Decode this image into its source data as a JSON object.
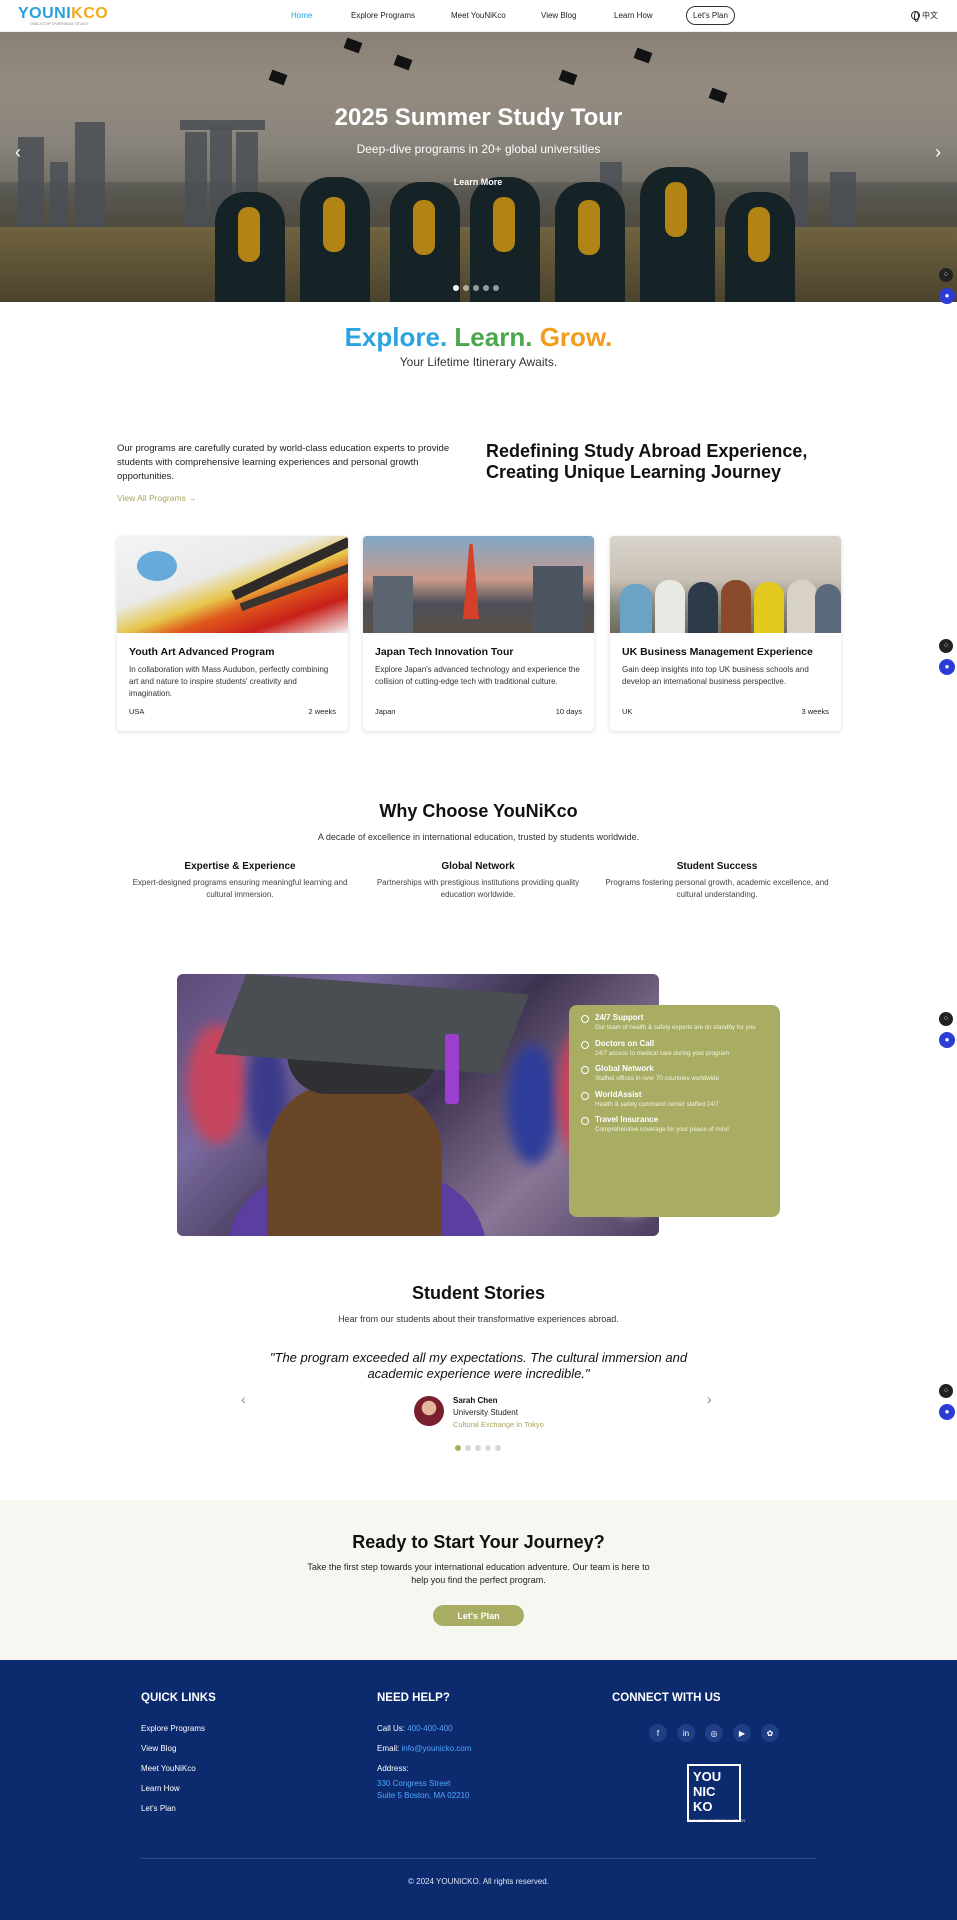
{
  "nav": {
    "logo_part1": "YOUNI",
    "logo_part2": "KCO",
    "logo_tagline": "ONE-STOP OVERSEAS STUDY",
    "links": [
      "Home",
      "Explore Programs",
      "Meet YouNiKco",
      "View Blog",
      "Learn How"
    ],
    "plan_button": "Let's Plan",
    "language": "中文"
  },
  "hero": {
    "title": "2025 Summer Study Tour",
    "subtitle": "Deep-dive programs in 20+ global universities",
    "button": "Learn More",
    "prev": "‹",
    "next": "›",
    "slide_count": 5,
    "active_slide": 1
  },
  "tagline": {
    "word1": "Explore.",
    "word2": "Learn.",
    "word3": "Grow.",
    "sub": "Your Lifetime Itinerary Awaits.",
    "colors": {
      "word1": "#2aa3e0",
      "word2": "#4aa84c",
      "word3": "#f29c1e"
    }
  },
  "intro": {
    "paragraph": "Our programs are carefully curated by world-class education experts to provide students with comprehensive learning experiences and personal growth opportunities.",
    "link": "View All Programs →",
    "heading": "Redefining Study Abroad Experience, Creating Unique Learning Journey"
  },
  "programs": [
    {
      "title": "Youth Art Advanced Program",
      "desc": "In collaboration with Mass Audubon, perfectly combining art and nature to inspire students' creativity and imagination.",
      "location": "USA",
      "duration": "2 weeks"
    },
    {
      "title": "Japan Tech Innovation Tour",
      "desc": "Explore Japan's advanced technology and experience the collision of cutting-edge tech with traditional culture.",
      "location": "Japan",
      "duration": "10 days"
    },
    {
      "title": "UK Business Management Experience",
      "desc": "Gain deep insights into top UK business schools and develop an international business perspective.",
      "location": "UK",
      "duration": "3 weeks"
    }
  ],
  "why": {
    "heading": "Why Choose YouNiKco",
    "sub": "A decade of excellence in international education, trusted by students worldwide.",
    "features": [
      {
        "title": "Expertise & Experience",
        "desc": "Expert-designed programs ensuring meaningful learning and cultural immersion."
      },
      {
        "title": "Global Network",
        "desc": "Partnerships with prestigious institutions providing quality education worldwide."
      },
      {
        "title": "Student Success",
        "desc": "Programs fostering personal growth, academic excellence, and cultural understanding."
      }
    ]
  },
  "support": [
    {
      "title": "24/7 Support",
      "desc": "Our team of health & safety experts are on standby for you"
    },
    {
      "title": "Doctors on Call",
      "desc": "24/7 access to medical care during your program"
    },
    {
      "title": "Global Network",
      "desc": "Staffed offices in over 70 countries worldwide"
    },
    {
      "title": "WorldAssist",
      "desc": "Health & safety command center staffed 24/7"
    },
    {
      "title": "Travel Insurance",
      "desc": "Comprehensive coverage for your peace of mind"
    }
  ],
  "stories": {
    "heading": "Student Stories",
    "sub": "Hear from our students about their transformative experiences abroad.",
    "quote": "\"The program exceeded all my expectations. The cultural immersion and academic experience were incredible.\"",
    "name": "Sarah Chen",
    "role": "University Student",
    "program": "Cultural Exchange in Tokyo",
    "prev": "‹",
    "next": "›",
    "dot_count": 5,
    "active_dot": 1
  },
  "cta": {
    "heading": "Ready to Start Your Journey?",
    "text": "Take the first step towards your international education adventure. Our team is here to help you find the perfect program.",
    "button": "Let's Plan"
  },
  "footer": {
    "quick_links_heading": "QUICK LINKS",
    "quick_links": [
      "Explore Programs",
      "View Blog",
      "Meet YouNiKco",
      "Learn How",
      "Let's Plan"
    ],
    "help_heading": "NEED HELP?",
    "call_label": "Call Us:",
    "call_value": "400-400-400",
    "email_label": "Email:",
    "email_value": "info@younicko.com",
    "address_label": "Address:",
    "address_line1": "330 Congress Street",
    "address_line2": "Suite 5 Boston, MA 02210",
    "connect_heading": "CONNECT WITH US",
    "social_icons": [
      "facebook-icon",
      "linkedin-icon",
      "instagram-icon",
      "youtube-icon",
      "wechat-icon"
    ],
    "logo_lines": [
      "YOU",
      "NIC",
      "KO"
    ],
    "logo_tagline": "ONE-STOP OVERSEAS STUDY",
    "copyright": "© 2024 YOUNICKO. All rights reserved."
  },
  "colors": {
    "accent_olive": "#a9ad63",
    "footer_navy": "#0c2a6e",
    "link_blue": "#2a9fd8"
  }
}
